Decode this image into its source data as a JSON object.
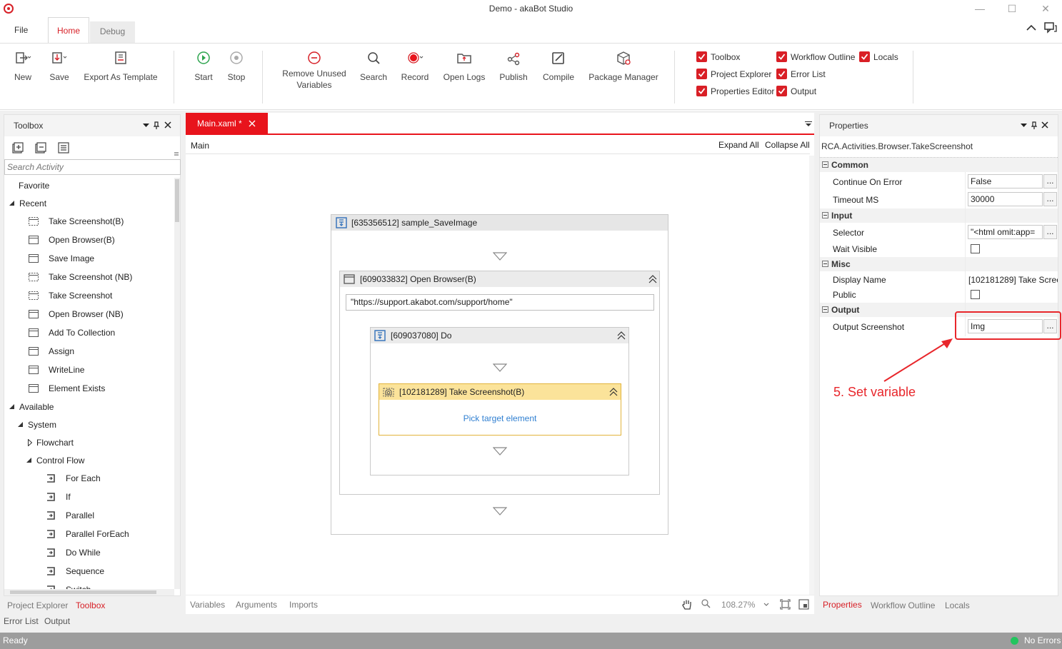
{
  "window": {
    "title": "Demo - akaBot Studio"
  },
  "tabs": {
    "file": "File",
    "home": "Home",
    "debug": "Debug"
  },
  "ribbon": {
    "new": "New",
    "save": "Save",
    "export_template": "Export As Template",
    "start": "Start",
    "stop": "Stop",
    "remove_unused_1": "Remove Unused",
    "remove_unused_2": "Variables",
    "search": "Search",
    "record": "Record",
    "open_logs": "Open Logs",
    "publish": "Publish",
    "compile": "Compile",
    "package_manager": "Package Manager",
    "checks": {
      "toolbox": "Toolbox",
      "project_explorer": "Project Explorer",
      "properties_editor": "Properties Editor",
      "workflow_outline": "Workflow Outline",
      "error_list": "Error List",
      "output": "Output",
      "locals": "Locals"
    }
  },
  "toolbox": {
    "title": "Toolbox",
    "search_placeholder": "Search Activity",
    "favorite": "Favorite",
    "recent": "Recent",
    "recent_items": [
      "Take Screenshot(B)",
      "Open Browser(B)",
      "Save Image",
      "Take Screenshot (NB)",
      "Take Screenshot",
      "Open Browser (NB)",
      "Add To Collection",
      "Assign",
      "WriteLine",
      "Element Exists"
    ],
    "available": "Available",
    "system": "System",
    "flowchart": "Flowchart",
    "control_flow": "Control Flow",
    "control_items": [
      "For Each",
      "If",
      "Parallel",
      "Parallel ForEach",
      "Do While",
      "Sequence",
      "Switch"
    ]
  },
  "designer": {
    "tab": "Main.xaml *",
    "breadcrumb": "Main",
    "expand_all": "Expand All",
    "collapse_all": "Collapse All",
    "outer_title": "[635356512] sample_SaveImage",
    "browser_title": "[609033832] Open Browser(B)",
    "browser_url": "\"https://support.akabot.com/support/home\"",
    "do_title": "[609037080] Do",
    "screenshot_title": "[102181289] Take Screenshot(B)",
    "pick_target": "Pick target element",
    "bottom_tabs": [
      "Variables",
      "Arguments",
      "Imports"
    ],
    "zoom": "108.27%"
  },
  "properties": {
    "title": "Properties",
    "type": "RCA.Activities.Browser.TakeScreenshot",
    "cat_common": "Common",
    "continue_on_error": "Continue On Error",
    "continue_on_error_value": "False",
    "timeout_ms": "Timeout MS",
    "timeout_value": "30000",
    "cat_input": "Input",
    "selector": "Selector",
    "selector_value": "\"<html omit:app=",
    "wait_visible": "Wait Visible",
    "cat_misc": "Misc",
    "display_name": "Display Name",
    "display_name_value": "[102181289] Take Scree",
    "public": "Public",
    "cat_output": "Output",
    "output_screenshot": "Output Screenshot",
    "output_screenshot_value": "Img",
    "dots": "...",
    "bottom_tabs": [
      "Properties",
      "Workflow Outline",
      "Locals"
    ]
  },
  "annotation": {
    "text": "5. Set variable",
    "color": "#e8262b"
  },
  "left_bottom_tabs": {
    "project_explorer": "Project Explorer",
    "toolbox": "Toolbox",
    "error_list": "Error List",
    "output": "Output"
  },
  "status": {
    "ready": "Ready",
    "errors": "No Errors"
  },
  "colors": {
    "accent": "#d72027",
    "status_ok": "#22c55e"
  }
}
